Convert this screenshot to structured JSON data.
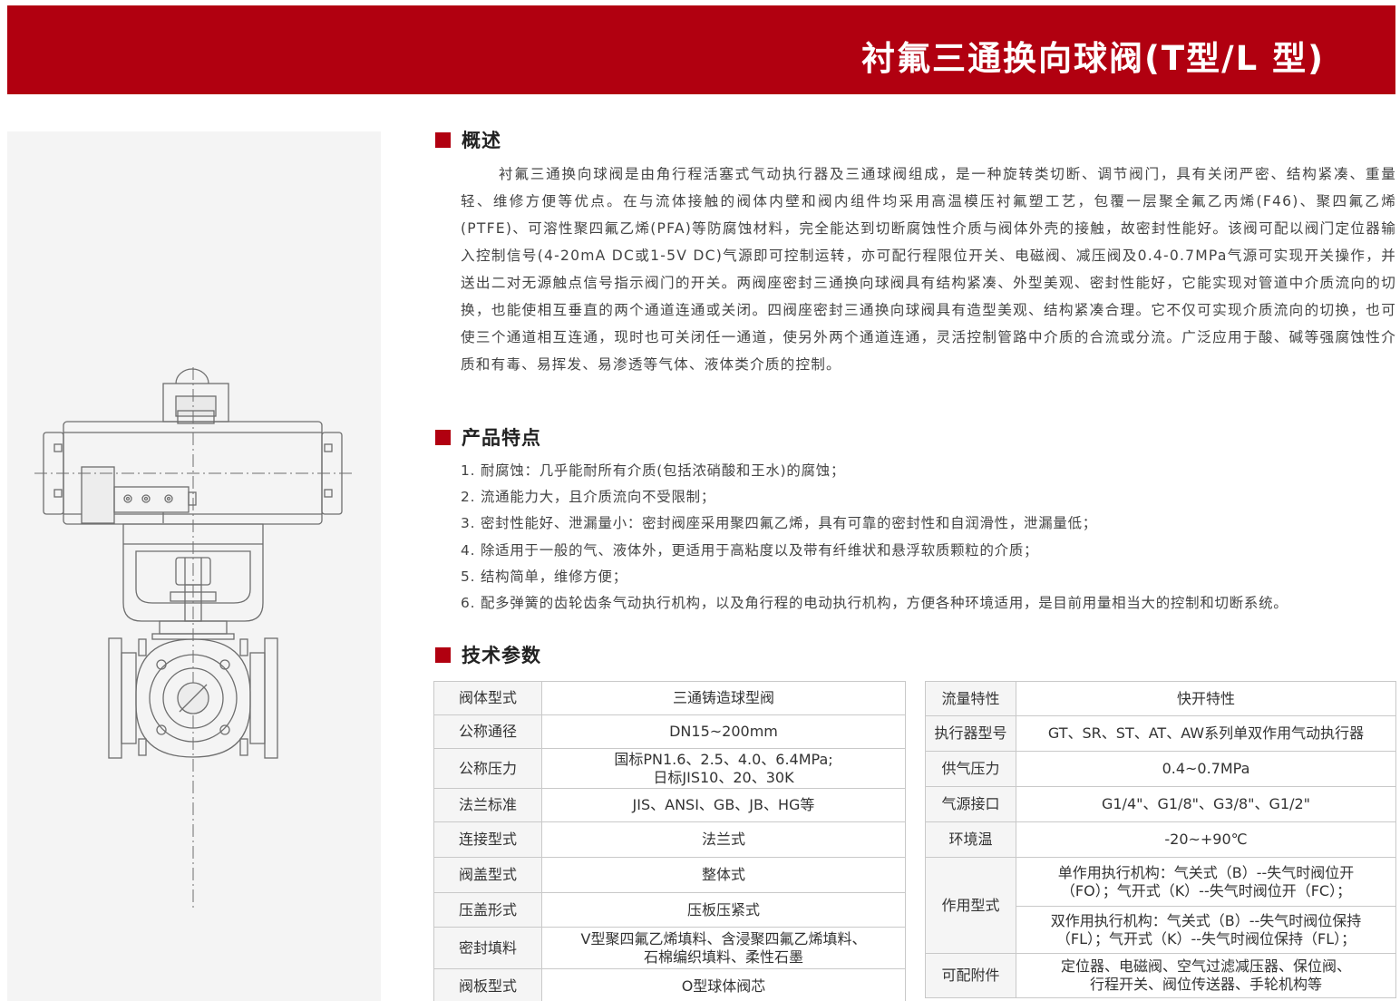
{
  "banner": {
    "title": "衬氟三通换向球阀(T型/L 型)",
    "color": "#b10010"
  },
  "overview": {
    "heading": "概述",
    "text": "衬氟三通换向球阀是由角行程活塞式气动执行器及三通球阀组成，是一种旋转类切断、调节阀门，具有关闭严密、结构紧凑、重量轻、维修方便等优点。在与流体接触的阀体内壁和阀内组件均采用高温模压衬氟塑工艺，包覆一层聚全氟乙丙烯(F46)、聚四氟乙烯(PTFE)、可溶性聚四氟乙烯(PFA)等防腐蚀材料，完全能达到切断腐蚀性介质与阀体外壳的接触，故密封性能好。该阀可配以阀门定位器输入控制信号(4-20mA DC或1-5V DC)气源即可控制运转，亦可配行程限位开关、电磁阀、减压阀及0.4-0.7MPa气源可实现开关操作，并送出二对无源触点信号指示阀门的开关。两阀座密封三通换向球阀具有结构紧凑、外型美观、密封性能好，它能实现对管道中介质流向的切换，也能使相互垂直的两个通道连通或关闭。四阀座密封三通换向球阀具有造型美观、结构紧凑合理。它不仅可实现介质流向的切换，也可使三个通道相互连通，现时也可关闭任一通道，使另外两个通道连通，灵活控制管路中介质的合流或分流。广泛应用于酸、碱等强腐蚀性介质和有毒、易挥发、易渗透等气体、液体类介质的控制。"
  },
  "features": {
    "heading": "产品特点",
    "items": [
      "1. 耐腐蚀：几乎能耐所有介质(包括浓硝酸和王水)的腐蚀；",
      "2. 流通能力大，且介质流向不受限制；",
      "3. 密封性能好、泄漏量小：密封阀座采用聚四氟乙烯，具有可靠的密封性和自润滑性，泄漏量低；",
      "4. 除适用于一般的气、液体外，更适用于高粘度以及带有纤维状和悬浮软质颗粒的介质；",
      "5. 结构简单，维修方便；",
      "6. 配多弹簧的齿轮齿条气动执行机构，以及角行程的电动执行机构，方便各种环境适用，是目前用量相当大的控制和切断系统。"
    ]
  },
  "specs": {
    "heading": "技术参数",
    "left": [
      {
        "key": "阀体型式",
        "lines": [
          "三通铸造球型阀"
        ]
      },
      {
        "key": "公称通径",
        "lines": [
          "DN15~200mm"
        ]
      },
      {
        "key": "公称压力",
        "lines": [
          "国标PN1.6、2.5、4.0、6.4MPa;",
          "日标JIS10、20、30K"
        ]
      },
      {
        "key": "法兰标准",
        "lines": [
          "JIS、ANSI、GB、JB、HG等"
        ]
      },
      {
        "key": "连接型式",
        "lines": [
          "法兰式"
        ]
      },
      {
        "key": "阀盖型式",
        "lines": [
          "整体式"
        ]
      },
      {
        "key": "压盖形式",
        "lines": [
          "压板压紧式"
        ]
      },
      {
        "key": "密封填料",
        "lines": [
          "V型聚四氟乙烯填料、含浸聚四氟乙烯填料、",
          "石棉编织填料、柔性石墨"
        ]
      },
      {
        "key": "阀板型式",
        "lines": [
          "O型球体阀芯"
        ]
      }
    ],
    "right": [
      {
        "key": "流量特性",
        "lines": [
          "快开特性"
        ]
      },
      {
        "key": "执行器型号",
        "lines": [
          "GT、SR、ST、AT、AW系列单双作用气动执行器"
        ]
      },
      {
        "key": "供气压力",
        "lines": [
          "0.4~0.7MPa"
        ]
      },
      {
        "key": "气源接口",
        "lines": [
          "G1/4\"、G1/8\"、G3/8\"、G1/2\""
        ]
      },
      {
        "key": "环境温",
        "lines": [
          "-20~+90℃"
        ]
      },
      {
        "key": "作用型式",
        "lines": [
          "单作用执行机构：气关式（B）--失气时阀位开",
          "（FO）；气开式（K）--失气时阀位开（FC）；"
        ],
        "lines2": [
          "双作用执行机构：气关式（B）--失气时阀位保持",
          "（FL）；气开式（K）--失气时阀位保持（FL）；"
        ]
      },
      {
        "key": "可配附件",
        "lines": [
          "定位器、电磁阀、空气过滤减压器、保位阀、",
          "行程开关、阀位传送器、手轮机构等"
        ]
      }
    ]
  }
}
